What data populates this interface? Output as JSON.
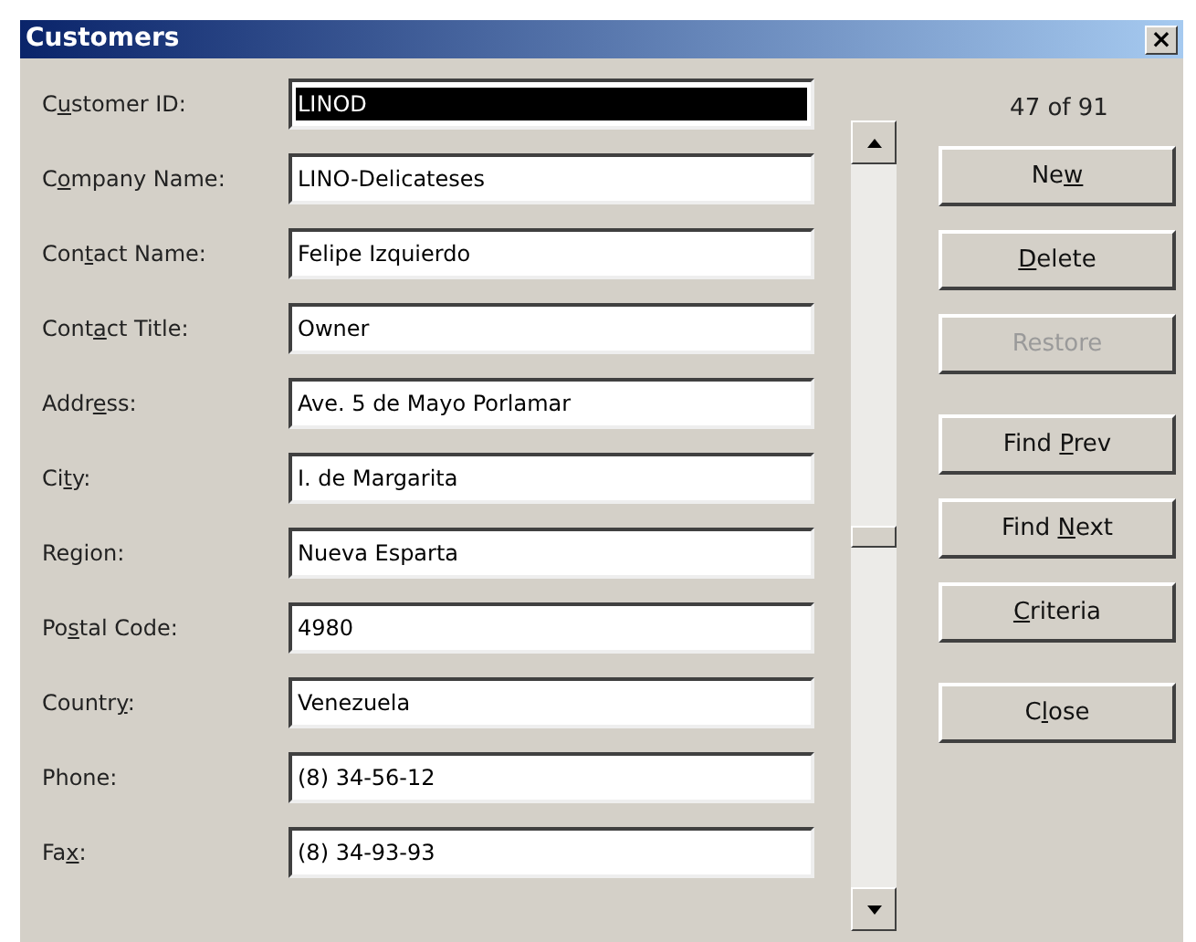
{
  "window": {
    "title": "Customers",
    "close_label": "×"
  },
  "fields": [
    {
      "label": {
        "before": "C",
        "key": "u",
        "after": "stomer ID:"
      },
      "value": "LINOD",
      "highlighted": true
    },
    {
      "label": {
        "before": "C",
        "key": "o",
        "after": "mpany Name:"
      },
      "value": "LINO-Delicateses",
      "highlighted": false
    },
    {
      "label": {
        "before": "Con",
        "key": "t",
        "after": "act Name:"
      },
      "value": "Felipe Izquierdo",
      "highlighted": false
    },
    {
      "label": {
        "before": "Cont",
        "key": "a",
        "after": "ct Title:"
      },
      "value": "Owner",
      "highlighted": false
    },
    {
      "label": {
        "before": "Addr",
        "key": "e",
        "after": "ss:"
      },
      "value": "Ave. 5 de Mayo Porlamar",
      "highlighted": false
    },
    {
      "label": {
        "before": "Ci",
        "key": "t",
        "after": "y:"
      },
      "value": "I. de Margarita",
      "highlighted": false
    },
    {
      "label": {
        "before": "Region:"
      },
      "value": "Nueva Esparta",
      "highlighted": false
    },
    {
      "label": {
        "before": "Po",
        "key": "s",
        "after": "tal Code:"
      },
      "value": "4980",
      "highlighted": false
    },
    {
      "label": {
        "before": "Countr",
        "key": "y",
        "after": ":"
      },
      "value": "Venezuela",
      "highlighted": false
    },
    {
      "label": {
        "before": "Phone:"
      },
      "value": "(8) 34-56-12",
      "highlighted": false
    },
    {
      "label": {
        "before": "Fa",
        "key": "x",
        "after": ":"
      },
      "value": "(8) 34-93-93",
      "highlighted": false
    }
  ],
  "record_counter": "47 of 91",
  "button_groups": [
    [
      {
        "label": {
          "before": "Ne",
          "key": "w"
        },
        "disabled": false
      },
      {
        "label": {
          "key": "D",
          "after": "elete"
        },
        "disabled": false
      },
      {
        "label": {
          "before": "Restore"
        },
        "disabled": true
      }
    ],
    [
      {
        "label": {
          "before": "Find ",
          "key": "P",
          "after": "rev"
        },
        "disabled": false
      },
      {
        "label": {
          "before": "Find ",
          "key": "N",
          "after": "ext"
        },
        "disabled": false
      },
      {
        "label": {
          "key": "C",
          "after": "riteria"
        },
        "disabled": false
      }
    ],
    [
      {
        "label": {
          "before": "C",
          "key": "l",
          "after": "ose"
        },
        "disabled": false
      }
    ]
  ]
}
